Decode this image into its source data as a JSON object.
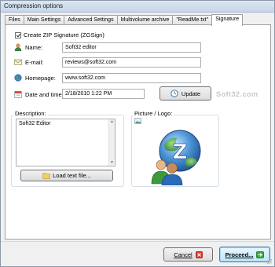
{
  "window": {
    "title": "Compression options"
  },
  "tabs": [
    {
      "label": "Files"
    },
    {
      "label": "Main Settings"
    },
    {
      "label": "Advanced Settings"
    },
    {
      "label": "Multivolume archive"
    },
    {
      "label": "\"ReadMe.txt\""
    },
    {
      "label": "Signature"
    }
  ],
  "signature": {
    "create_label": "Create ZIP Signature (ZGSign)",
    "name_label": "Name:",
    "name_value": "Soft32 editor",
    "email_label": "E-mail:",
    "email_value": "reviews@soft32.com",
    "homepage_label": "Homepage:",
    "homepage_value": "www.soft32.com",
    "datetime_label": "Date and time:",
    "datetime_value": "2/18/2010 1:22 PM",
    "update_label": "Update"
  },
  "description": {
    "group_label": "Description:",
    "text": "Soft32 Editor",
    "load_label": "Load text file..."
  },
  "picture": {
    "group_label": "Picture / Logo:"
  },
  "watermark": "Soft32.com",
  "footer": {
    "cancel_label": "Cancel",
    "proceed_label": "Proceed..."
  },
  "colors": {
    "accent": "#2f6ea8",
    "logo_green": "#3c9a3c",
    "logo_blue": "#2a6ab8"
  }
}
